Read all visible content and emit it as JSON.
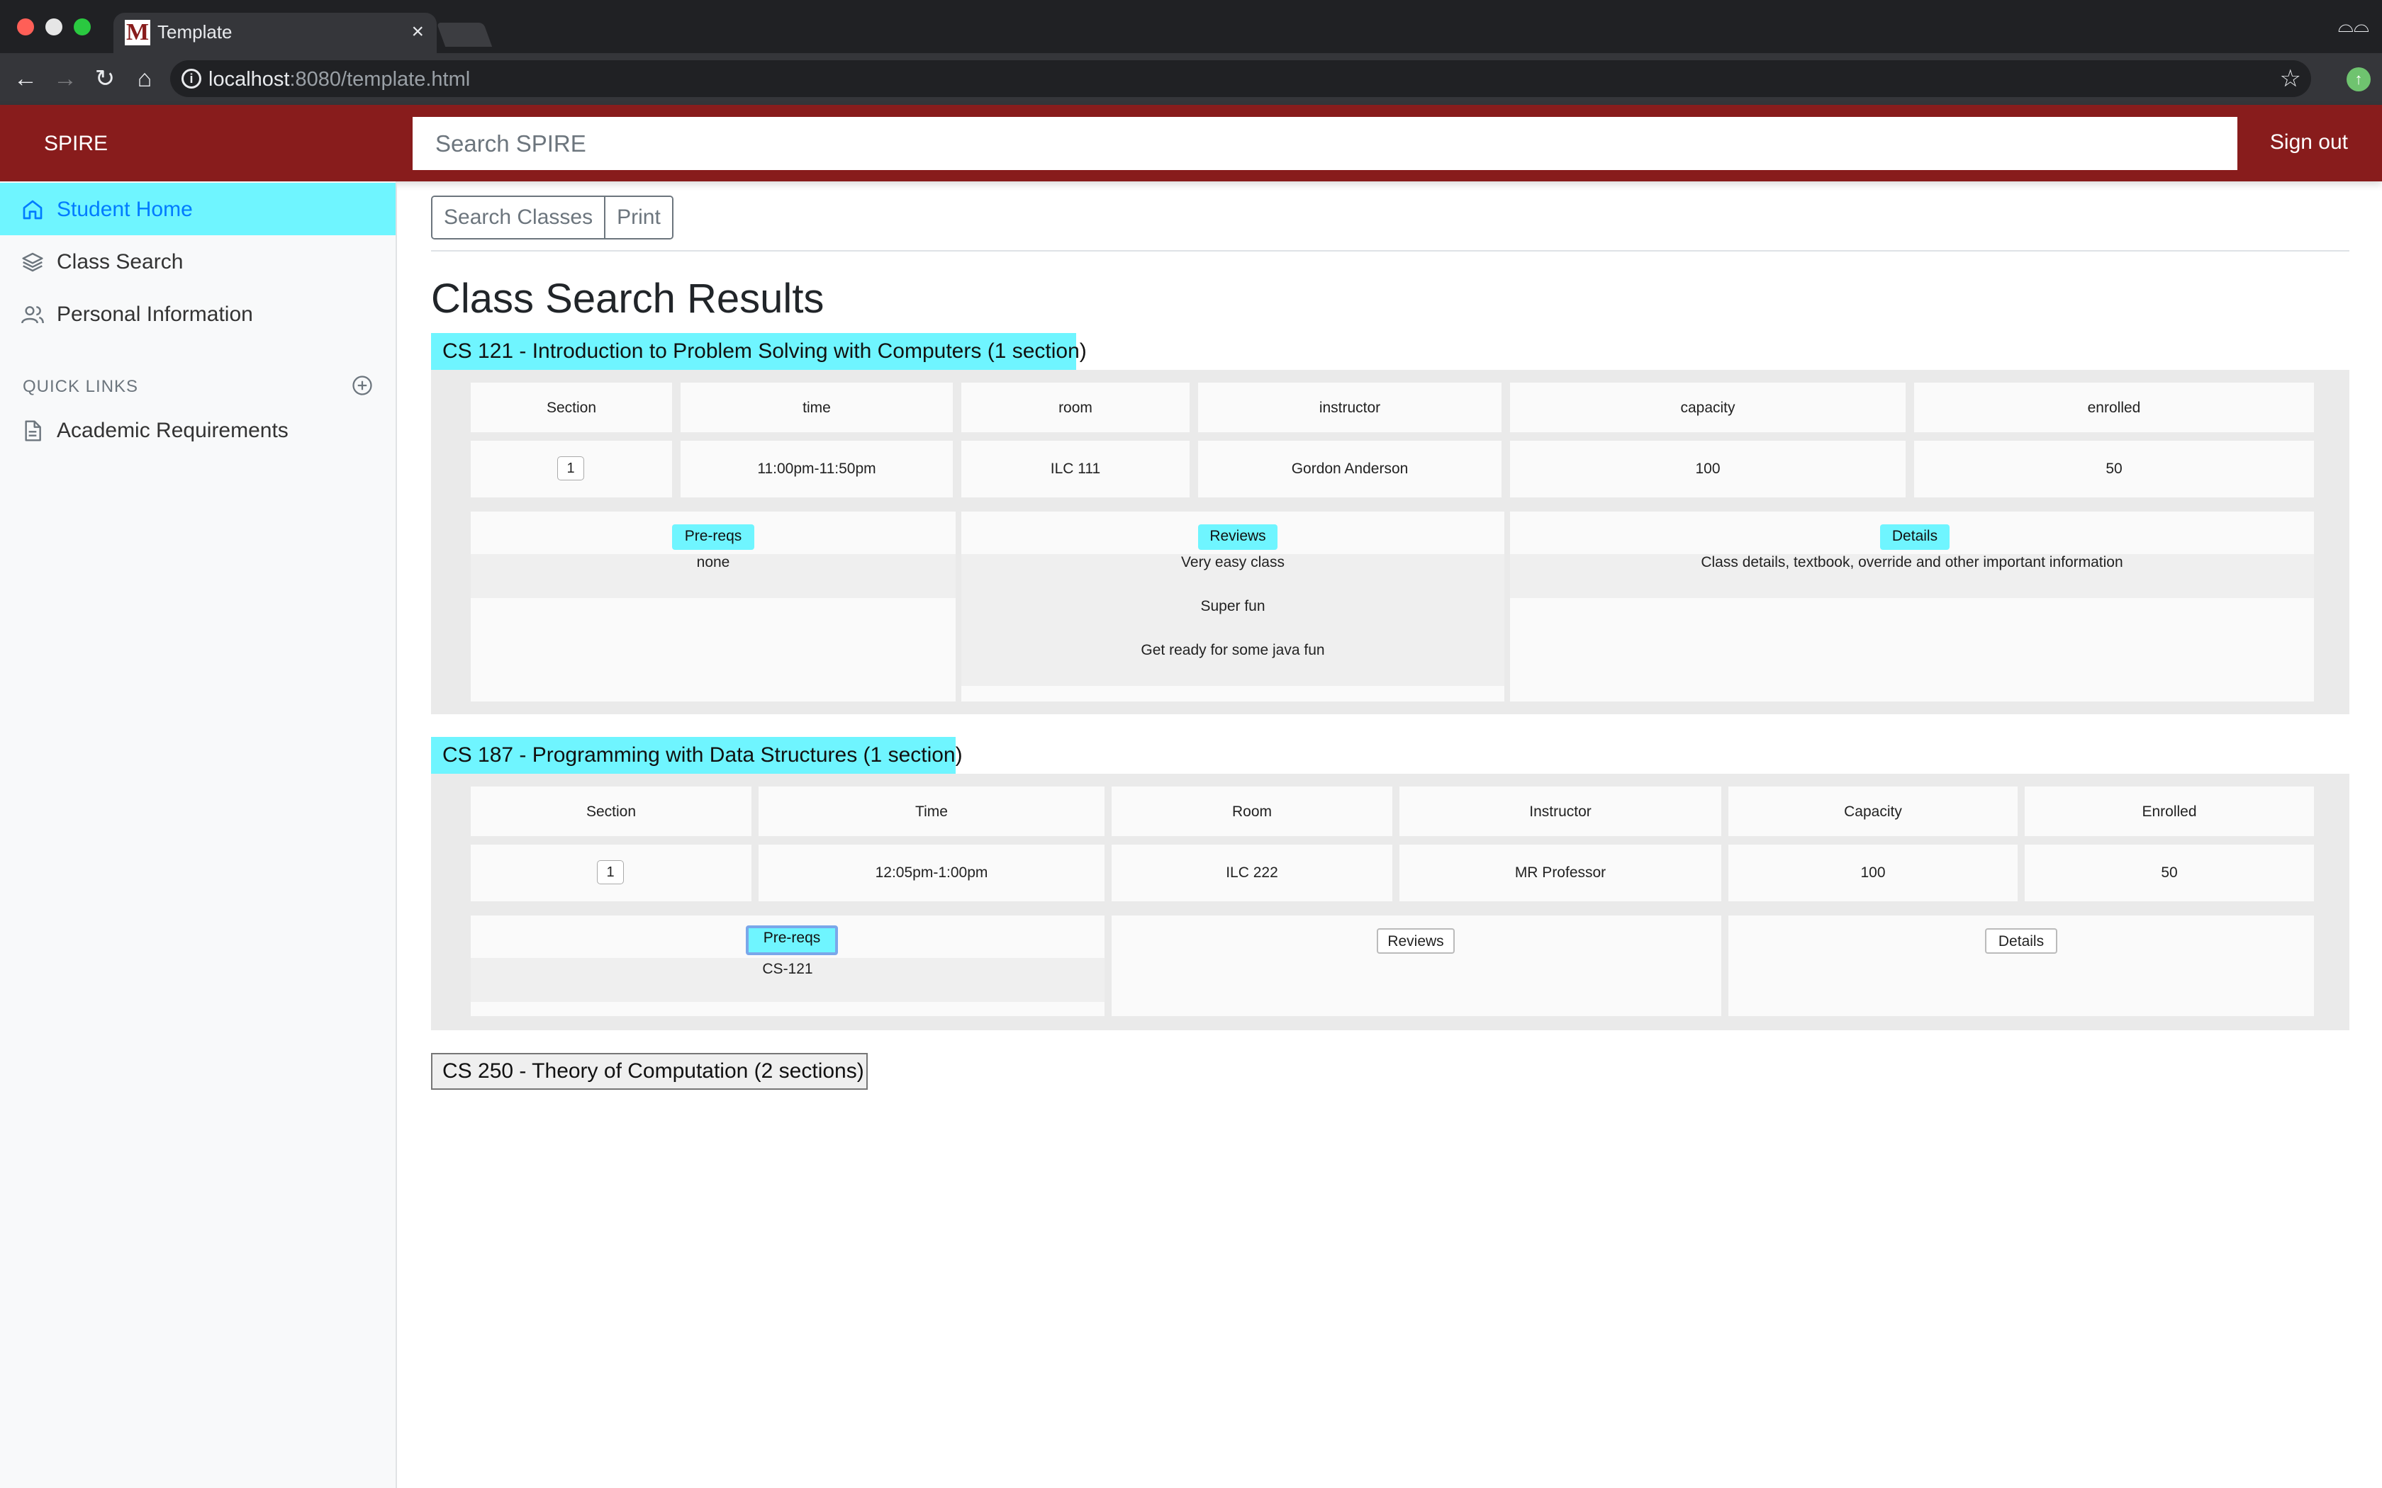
{
  "browser": {
    "tab_title": "Template",
    "favicon_letter": "M",
    "url_host": "localhost",
    "url_path": ":8080/template.html"
  },
  "header": {
    "brand": "SPIRE",
    "search_placeholder": "Search SPIRE",
    "sign_out": "Sign out"
  },
  "sidebar": {
    "items": [
      {
        "label": "Student Home",
        "icon": "home-icon",
        "active": true
      },
      {
        "label": "Class Search",
        "icon": "layers-icon"
      },
      {
        "label": "Personal Information",
        "icon": "users-icon"
      }
    ],
    "quick_links_title": "QUICK LINKS",
    "quick_links": [
      {
        "label": "Academic Requirements",
        "icon": "file-icon"
      }
    ]
  },
  "toolbar": {
    "search_classes": "Search Classes",
    "print": "Print"
  },
  "page_title": "Class Search Results",
  "courses": [
    {
      "heading": "CS 121 - Introduction to Problem Solving with Computers (1 section)",
      "columns": [
        "Section",
        "time",
        "room",
        "instructor",
        "capacity",
        "enrolled"
      ],
      "row": {
        "section": "1",
        "time": "11:00pm-11:50pm",
        "room": "ILC 111",
        "instructor": "Gordon Anderson",
        "capacity": "100",
        "enrolled": "50"
      },
      "prereqs_label": "Pre-reqs",
      "prereqs": "none",
      "reviews_label": "Reviews",
      "reviews": [
        "Very easy class",
        "Super fun",
        "Get ready for some java fun"
      ],
      "details_label": "Details",
      "details": "Class details, textbook, override and other important information"
    },
    {
      "heading": "CS 187 - Programming with Data Structures (1 section)",
      "columns": [
        "Section",
        "Time",
        "Room",
        "Instructor",
        "Capacity",
        "Enrolled"
      ],
      "row": {
        "section": "1",
        "time": "12:05pm-1:00pm",
        "room": "ILC 222",
        "instructor": "MR Professor",
        "capacity": "100",
        "enrolled": "50"
      },
      "prereqs_label": "Pre-reqs",
      "prereqs": "CS-121",
      "reviews_label": "Reviews",
      "details_label": "Details"
    },
    {
      "heading": "CS 250 - Theory of Computation (2 sections)"
    }
  ],
  "colors": {
    "brand": "#881c1c",
    "accent_cyan": "#6ff5ff",
    "link_blue": "#007bff"
  }
}
